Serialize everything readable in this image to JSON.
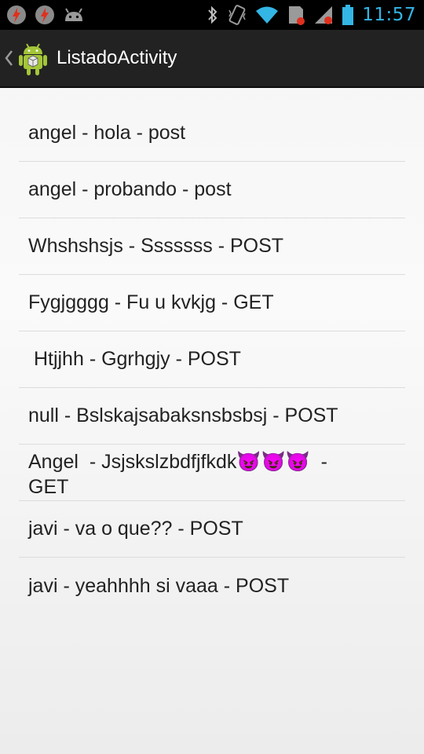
{
  "status_bar": {
    "left_icons": [
      "flash-icon",
      "flash-icon",
      "android-debug-icon"
    ],
    "right_icons": [
      "bluetooth-icon",
      "vibrate-icon",
      "wifi-icon",
      "sd-card-icon",
      "signal-icon",
      "battery-icon"
    ],
    "time": "11:57",
    "time_color": "#33b5e5"
  },
  "action_bar": {
    "title": "ListadoActivity",
    "background": "#222222"
  },
  "list": {
    "items": [
      "angel - hola - post",
      "angel - probando - post",
      "Whshshsjs - Sssssss - POST",
      "Fygjgggg - Fu u kvkjg - GET",
      " Htjjhh - Ggrhgjy - POST",
      "null - Bslskajsabaksnsbsbsj - POST",
      "Angel  - Jsjskslzbdfjfkdk😈😈😈  - GET",
      "javi - va o que?? - POST",
      "javi - yeahhhh si vaaa - POST"
    ]
  }
}
